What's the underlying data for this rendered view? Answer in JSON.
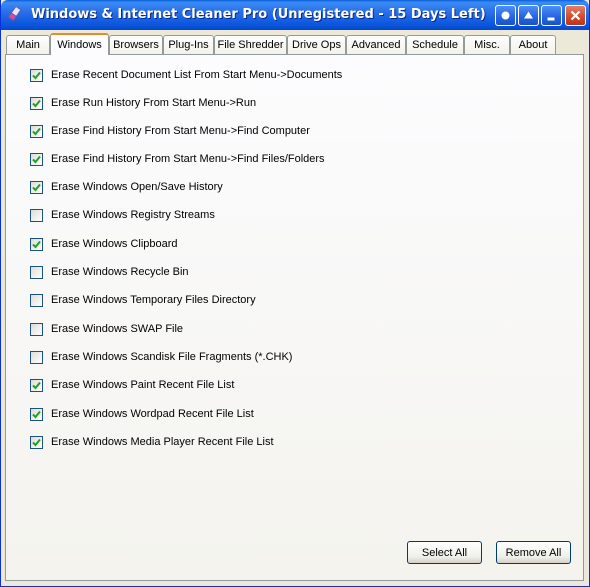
{
  "window": {
    "title": "Windows & Internet Cleaner Pro (Unregistered - 15 Days Left)"
  },
  "tabs": [
    {
      "label": "Main"
    },
    {
      "label": "Windows"
    },
    {
      "label": "Browsers"
    },
    {
      "label": "Plug-Ins"
    },
    {
      "label": "File Shredder"
    },
    {
      "label": "Drive Ops"
    },
    {
      "label": "Advanced"
    },
    {
      "label": "Schedule"
    },
    {
      "label": "Misc."
    },
    {
      "label": "About"
    }
  ],
  "active_tab": "Windows",
  "options": [
    {
      "label": "Erase Recent Document List From Start Menu->Documents",
      "checked": true
    },
    {
      "label": "Erase Run History From Start Menu->Run",
      "checked": true
    },
    {
      "label": "Erase Find History From Start Menu->Find Computer",
      "checked": true
    },
    {
      "label": "Erase Find History From Start Menu->Find Files/Folders",
      "checked": true
    },
    {
      "label": "Erase Windows Open/Save History",
      "checked": true
    },
    {
      "label": "Erase Windows Registry Streams",
      "checked": false
    },
    {
      "label": "Erase Windows Clipboard",
      "checked": true
    },
    {
      "label": "Erase Windows Recycle Bin",
      "checked": false
    },
    {
      "label": "Erase Windows Temporary Files Directory",
      "checked": false
    },
    {
      "label": "Erase Windows SWAP File",
      "checked": false
    },
    {
      "label": "Erase Windows Scandisk File Fragments (*.CHK)",
      "checked": false
    },
    {
      "label": "Erase Windows Paint Recent File List",
      "checked": true
    },
    {
      "label": "Erase Windows Wordpad Recent File List",
      "checked": true
    },
    {
      "label": "Erase Windows Media Player Recent File List",
      "checked": true
    }
  ],
  "buttons": {
    "select_all": "Select All",
    "remove_all": "Remove All"
  },
  "icons": {
    "app": "eraser-icon",
    "titlebar": [
      "help-icon",
      "restore-up-icon",
      "minimize-icon",
      "close-icon"
    ]
  },
  "colors": {
    "titlebar": "#0855dd",
    "active_tab_accent": "#e68b2c",
    "checkmark": "#21a121"
  }
}
